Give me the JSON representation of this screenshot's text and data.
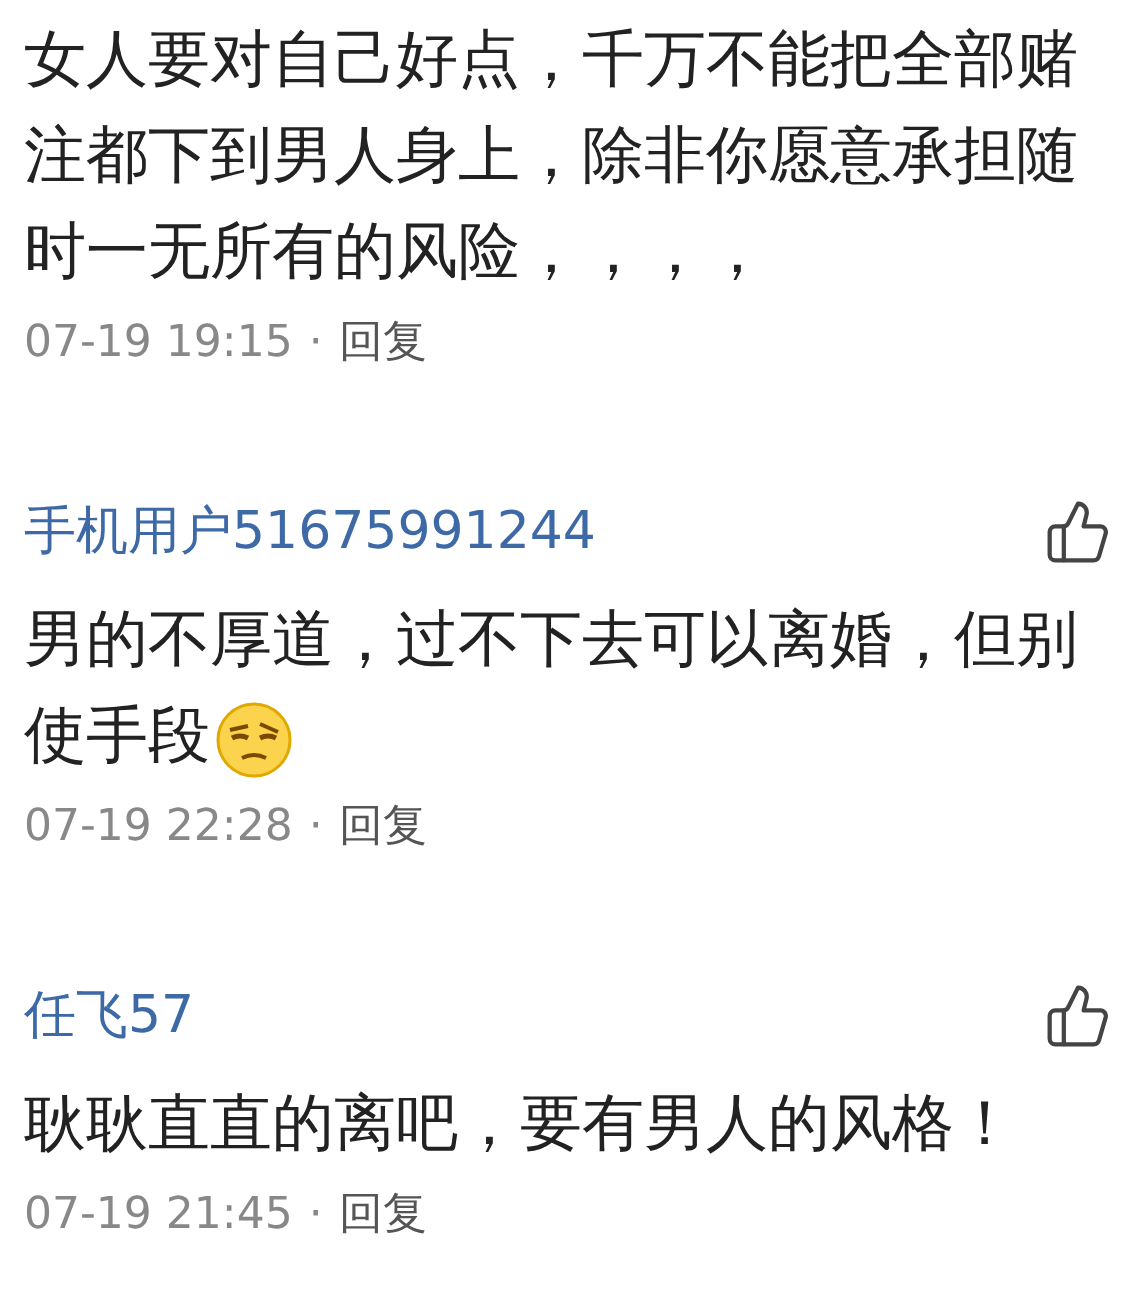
{
  "comments": [
    {
      "text": "女人要对自己好点，千万不能把全部赌注都下到男人身上，除非你愿意承担随时一无所有的风险，，，，",
      "emoji": false,
      "time": "07-19 19:15",
      "separator": "·",
      "reply": "回复"
    },
    {
      "user": "手机用户51675991244",
      "text": "男的不厚道，过不下去可以离婚，但别使手段",
      "emoji": true,
      "time": "07-19 22:28",
      "separator": "·",
      "reply": "回复"
    },
    {
      "user": "任飞57",
      "text": "耿耿直直的离吧，要有男人的风格！",
      "emoji": false,
      "time": "07-19 21:45",
      "separator": "·",
      "reply": "回复"
    }
  ]
}
